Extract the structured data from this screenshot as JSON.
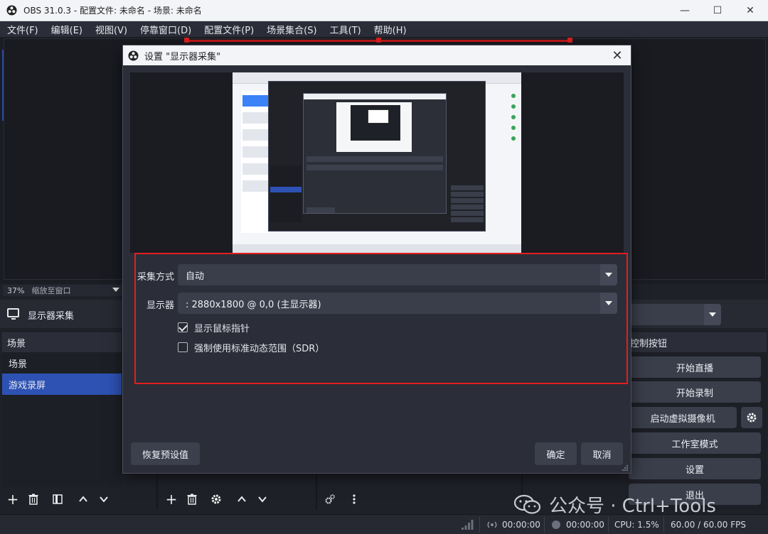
{
  "window": {
    "title": "OBS 31.0.3 - 配置文件: 未命名 - 场景: 未命名",
    "minimize_glyph": "—",
    "maximize_glyph": "☐",
    "close_glyph": "✕"
  },
  "menu": [
    "文件(F)",
    "编辑(E)",
    "视图(V)",
    "停靠窗口(D)",
    "配置文件(P)",
    "场景集合(S)",
    "工具(T)",
    "帮助(H)"
  ],
  "preview": {
    "zoom": "37%",
    "zoom_label": "缩放至窗口"
  },
  "source_bar": {
    "source_name": "显示器采集"
  },
  "scenes": {
    "header": "场景",
    "items": [
      {
        "label": "场景",
        "selected": false
      },
      {
        "label": "游戏录屏",
        "selected": true
      }
    ]
  },
  "controls": {
    "header": "控制按钮",
    "buttons": [
      "开始直播",
      "开始录制",
      "启动虚拟摄像机",
      "工作室模式",
      "设置",
      "退出"
    ]
  },
  "statusbar": {
    "stream_time": "00:00:00",
    "record_time": "00:00:00",
    "cpu": "CPU: 1.5%",
    "fps": "60.00 / 60.00 FPS"
  },
  "dialog": {
    "title": "设置 \"显示器采集\"",
    "capture_method_label": "采集方式",
    "capture_method_value": "自动",
    "display_label": "显示器",
    "display_value": ": 2880x1800 @ 0,0 (主显示器)",
    "show_cursor_label": "显示鼠标指针",
    "show_cursor_checked": true,
    "force_sdr_label": "强制使用标准动态范围（SDR）",
    "force_sdr_checked": false,
    "restore_defaults": "恢复预设值",
    "ok": "确定",
    "cancel": "取消"
  },
  "watermark": {
    "text": "公众号 · Ctrl+Tools"
  },
  "colors": {
    "accent_selected": "#2d52b3",
    "highlight_box": "#e31e1e",
    "background": "#1f2129"
  }
}
